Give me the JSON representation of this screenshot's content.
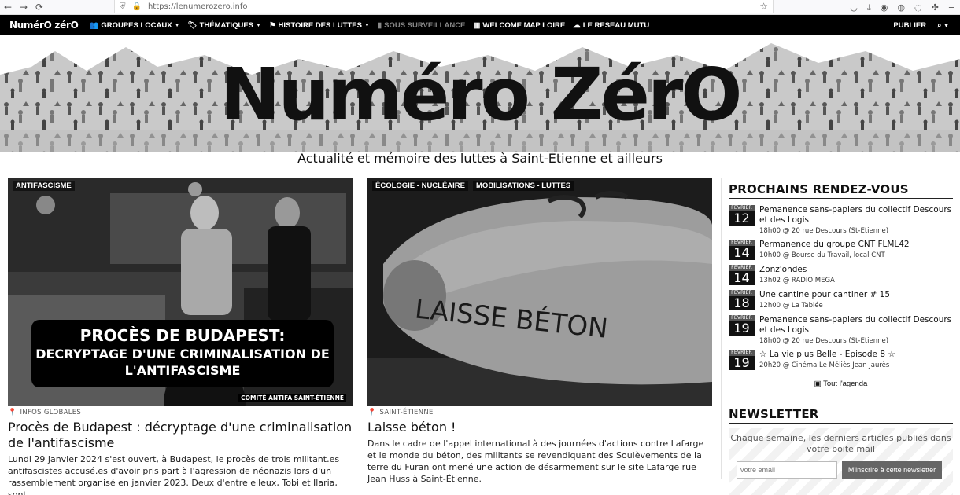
{
  "browser": {
    "url": "https://lenumerozero.info",
    "back_icon": "←",
    "forward_icon": "→",
    "reload_icon": "⟳"
  },
  "nav": {
    "logo": "NumérO zérO",
    "items": [
      {
        "icon": "👥",
        "label": "GROUPES LOCAUX",
        "caret": true,
        "muted": false
      },
      {
        "icon": "🏷",
        "label": "THÉMATIQUES",
        "caret": true,
        "muted": false
      },
      {
        "icon": "⚑",
        "label": "HISTOIRE DES LUTTES",
        "caret": true,
        "muted": false
      },
      {
        "icon": "▮",
        "label": "SOUS SURVEILLANCE",
        "caret": false,
        "muted": true
      },
      {
        "icon": "▦",
        "label": "WELCOME MAP LOIRE",
        "caret": false,
        "muted": false
      },
      {
        "icon": "☁",
        "label": "LE RESEAU MUTU",
        "caret": false,
        "muted": false
      }
    ],
    "publish": "PUBLIER"
  },
  "banner": {
    "title": "Numéro ZérO",
    "tagline": "Actualité et mémoire des luttes à Saint-Étienne et ailleurs"
  },
  "articles": [
    {
      "tags": [
        "ANTIFASCISME"
      ],
      "overlay": [
        "PROCÈS DE BUDAPEST:",
        "DECRYPTAGE D'UNE CRIMINALISATION DE",
        "L'ANTIFASCISME"
      ],
      "credit": "COMITÉ ANTIFA SAINT-ÉTIENNE",
      "location": "INFOS GLOBALES",
      "title": "Procès de Budapest : décryptage d'une criminalisation de l'antifascisme",
      "body": "Lundi 29 janvier 2024 s'est ouvert, à Budapest, le procès de trois militant.es antifascistes accusé.es d'avoir pris part à l'agression de néonazis lors d'un rassemblement organisé en janvier 2023. Deux d'entre elleux, Tobi et Ilaria, sont"
    },
    {
      "tags": [
        "ÉCOLOGIE - NUCLÉAIRE",
        "MOBILISATIONS - LUTTES"
      ],
      "location": "SAINT-ÉTIENNE",
      "title": "Laisse béton !",
      "body": "Dans le cadre de l'appel international à des journées d'actions contre Lafarge et le monde du béton, des militants se revendiquant des Soulèvements de la terre du Furan ont mené une action de désarmement sur le site Lafarge rue Jean Huss à Saint-Étienne.",
      "graffiti": "LAISSE BÉTON"
    }
  ],
  "sidebar": {
    "heading": "PROCHAINS RENDEZ-VOUS",
    "events": [
      {
        "month": "FÉVRIER",
        "day": "12",
        "title": "Pemanence sans-papiers du collectif Descours et des Logis",
        "meta": "18h00 @ 20 rue Descours (St-Etienne)"
      },
      {
        "month": "FÉVRIER",
        "day": "14",
        "title": "Permanence du groupe CNT FLML42",
        "meta": "10h00 @ Bourse du Travail, local CNT"
      },
      {
        "month": "FÉVRIER",
        "day": "14",
        "title": "Zonz'ondes",
        "meta": "13h02 @ RADIO MEGA"
      },
      {
        "month": "FÉVRIER",
        "day": "18",
        "title": "Une cantine pour cantiner # 15",
        "meta": "12h00 @ La Tablée"
      },
      {
        "month": "FÉVRIER",
        "day": "19",
        "title": "Pemanence sans-papiers du collectif Descours et des Logis",
        "meta": "18h00 @ 20 rue Descours (St-Etienne)"
      },
      {
        "month": "FÉVRIER",
        "day": "19",
        "title": "☆ La vie plus Belle - Episode 8 ☆",
        "meta": "20h20 @ Cinéma Le Méliès Jean Jaurès"
      }
    ],
    "agenda_link": "Tout l'agenda",
    "newsletter": {
      "heading": "NEWSLETTER",
      "text": "Chaque semaine, les derniers articles publiés dans votre boite mail",
      "placeholder": "votre email",
      "button": "M'inscrire à cette newsletter"
    }
  }
}
